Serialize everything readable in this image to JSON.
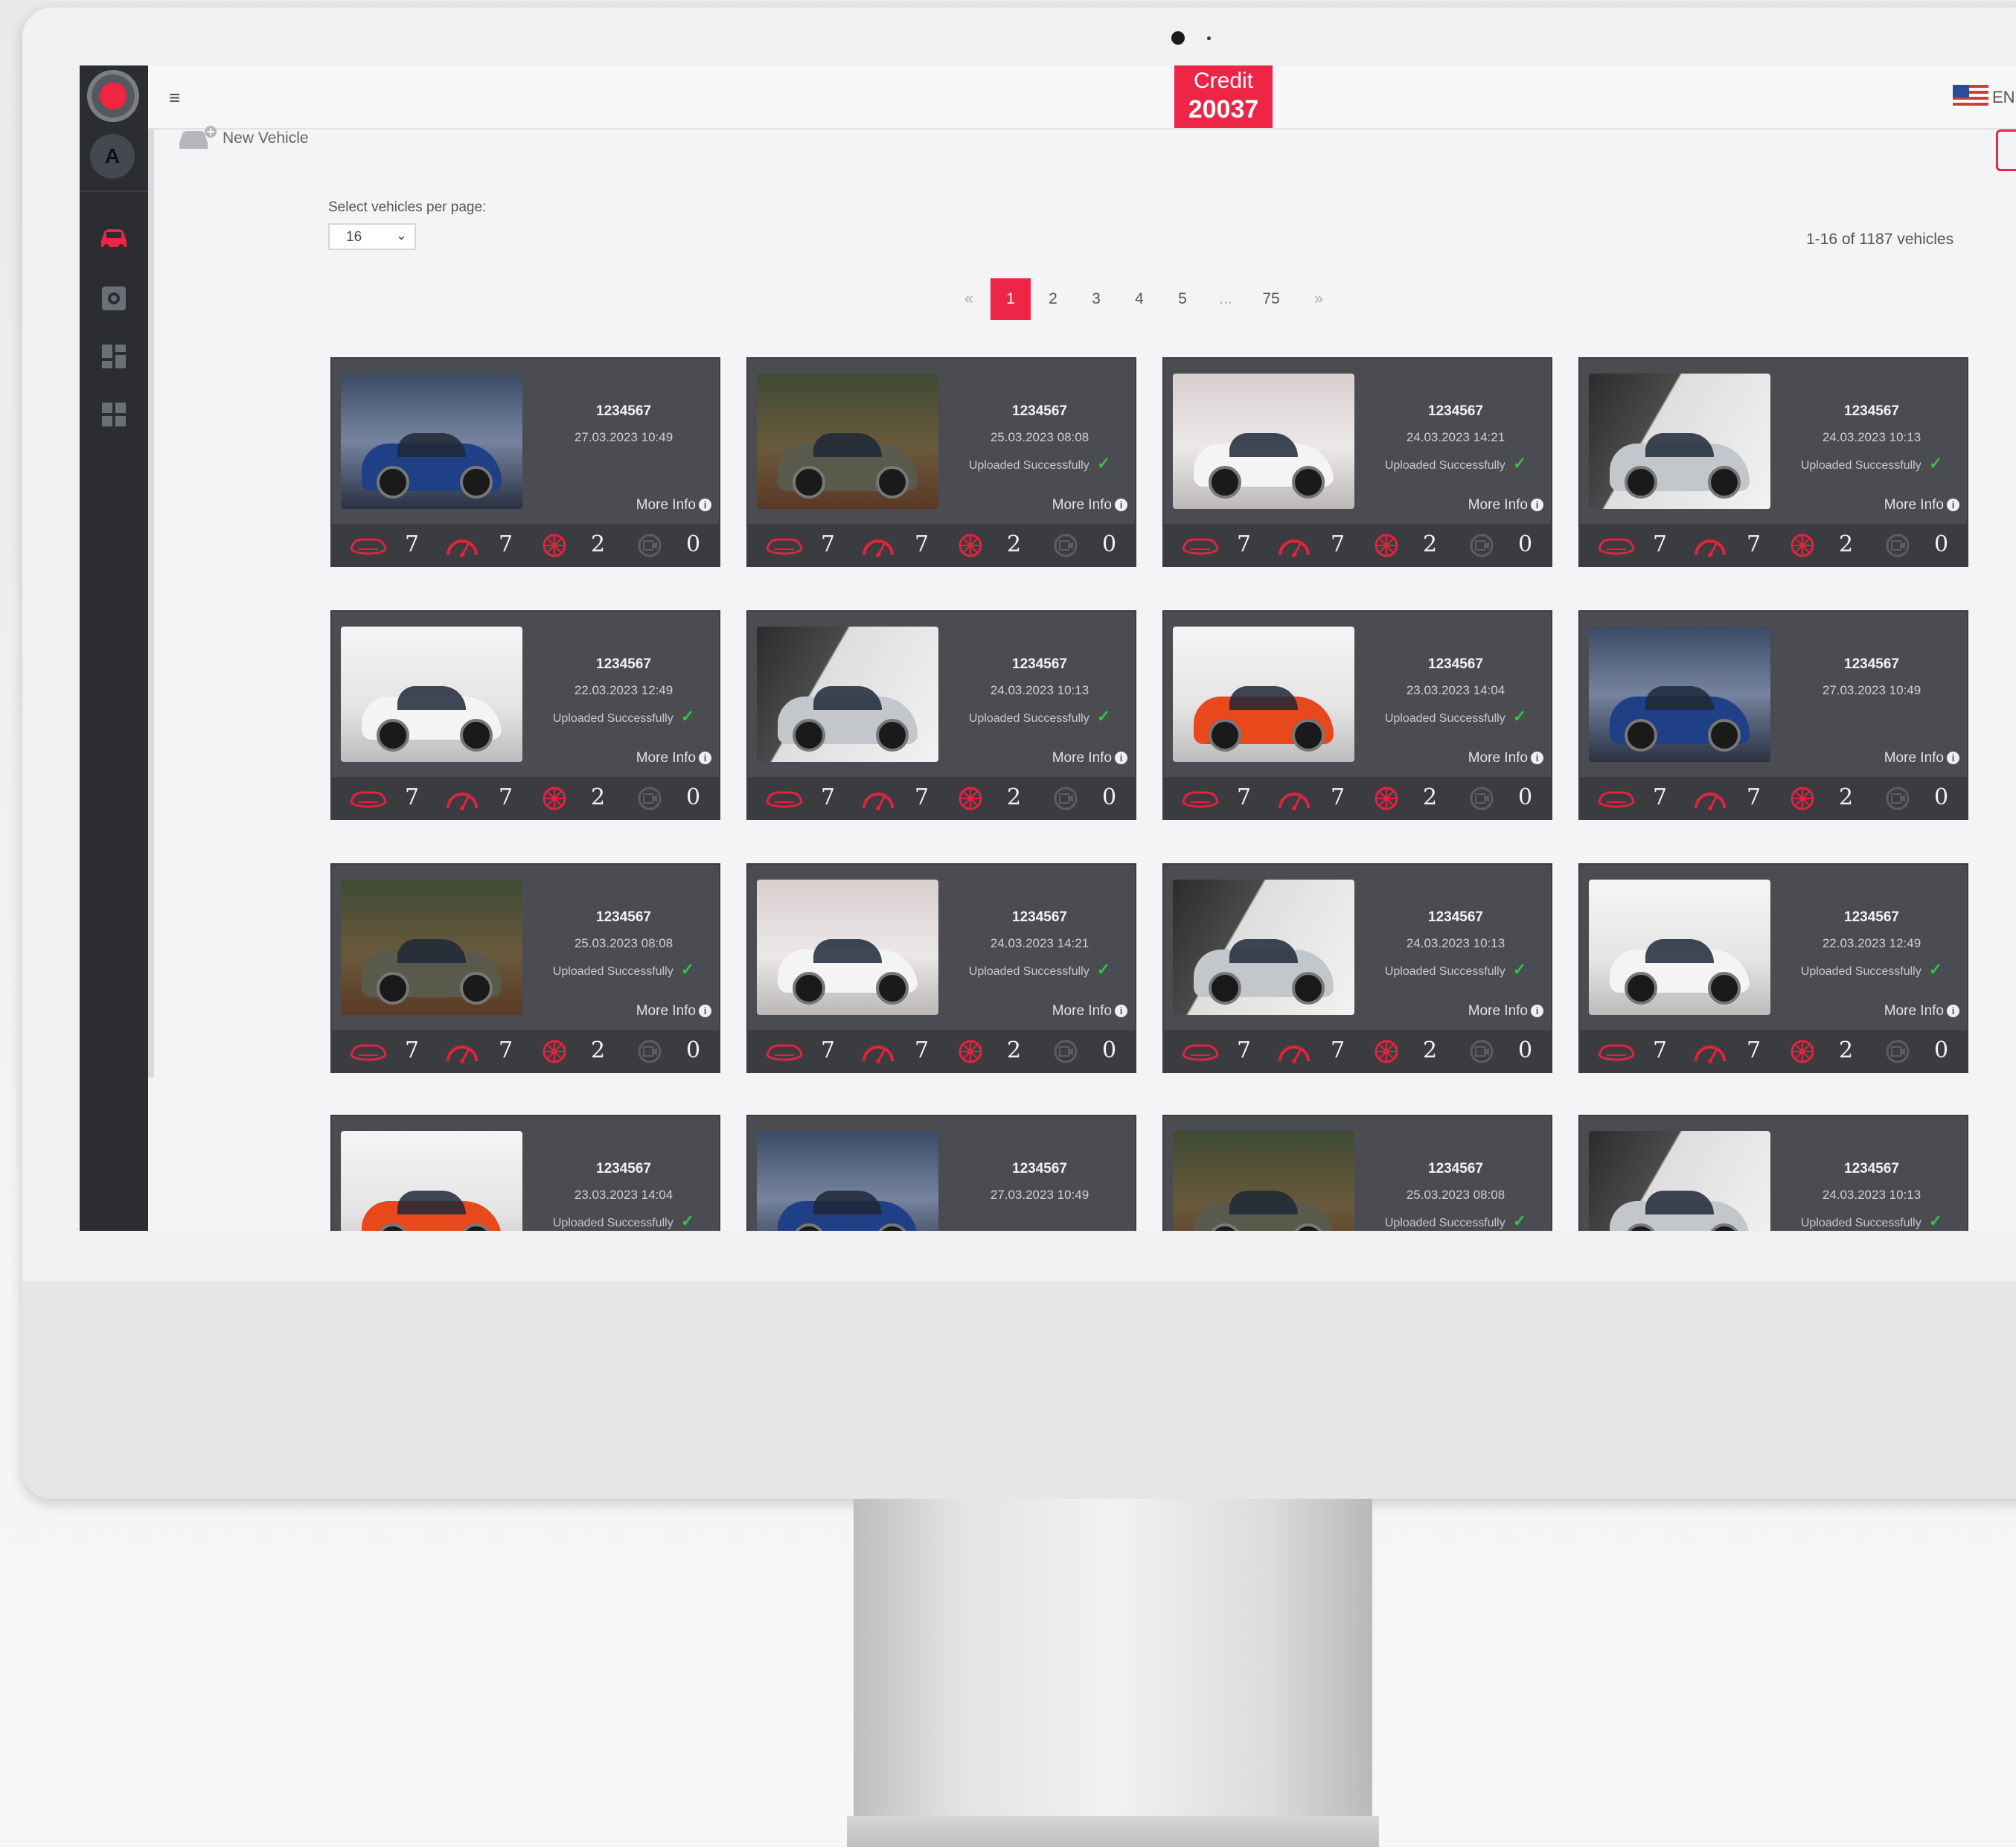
{
  "topbar": {
    "credit_label": "Credit",
    "credit_value": "20037",
    "language": "EN"
  },
  "toolbar": {
    "new_vehicle_label": "New Vehicle"
  },
  "per_page": {
    "label": "Select vehicles per page:",
    "value": "16"
  },
  "count_text": "1-16 of 1187 vehicles",
  "pagination": {
    "prev": "«",
    "pages": [
      "1",
      "2",
      "3",
      "4",
      "5",
      "...",
      "75"
    ],
    "next": "»",
    "active": "1"
  },
  "colors": {
    "accent": "#ee2547",
    "sidebar": "#2b2d31",
    "card": "#4a4c51",
    "success": "#32c24d"
  },
  "vehicles": [
    {
      "id": "1234567",
      "date": "27.03.2023 10:49",
      "status": "",
      "more": "More Info",
      "stats": [
        "7",
        "7",
        "2",
        "0"
      ],
      "image": "blue suv in studio"
    },
    {
      "id": "1234567",
      "date": "25.03.2023 08:08",
      "status": "Uploaded Successfully",
      "more": "More Info",
      "stats": [
        "7",
        "7",
        "2",
        "0"
      ],
      "image": "olive suv in forest studio"
    },
    {
      "id": "1234567",
      "date": "24.03.2023 14:21",
      "status": "Uploaded Successfully",
      "more": "More Info",
      "stats": [
        "7",
        "7",
        "2",
        "0"
      ],
      "image": "white sedan"
    },
    {
      "id": "1234567",
      "date": "24.03.2023 10:13",
      "status": "Uploaded Successfully",
      "more": "More Info",
      "stats": [
        "7",
        "7",
        "2",
        "0"
      ],
      "image": "silver suv catch studio"
    },
    {
      "id": "1234567",
      "date": "22.03.2023 12:49",
      "status": "Uploaded Successfully",
      "more": "More Info",
      "stats": [
        "7",
        "7",
        "2",
        "0"
      ],
      "image": "white sedan bright room"
    },
    {
      "id": "1234567",
      "date": "24.03.2023 10:13",
      "status": "Uploaded Successfully",
      "more": "More Info",
      "stats": [
        "7",
        "7",
        "2",
        "0"
      ],
      "image": "silver suv catch studio"
    },
    {
      "id": "1234567",
      "date": "23.03.2023 14:04",
      "status": "Uploaded Successfully",
      "more": "More Info",
      "stats": [
        "7",
        "7",
        "2",
        "0"
      ],
      "image": "orange hatchback"
    },
    {
      "id": "1234567",
      "date": "27.03.2023 10:49",
      "status": "",
      "more": "More Info",
      "stats": [
        "7",
        "7",
        "2",
        "0"
      ],
      "image": "blue suv in studio"
    },
    {
      "id": "1234567",
      "date": "25.03.2023 08:08",
      "status": "Uploaded Successfully",
      "more": "More Info",
      "stats": [
        "7",
        "7",
        "2",
        "0"
      ],
      "image": "olive suv in forest studio"
    },
    {
      "id": "1234567",
      "date": "24.03.2023 14:21",
      "status": "Uploaded Successfully",
      "more": "More Info",
      "stats": [
        "7",
        "7",
        "2",
        "0"
      ],
      "image": "white sedan"
    },
    {
      "id": "1234567",
      "date": "24.03.2023 10:13",
      "status": "Uploaded Successfully",
      "more": "More Info",
      "stats": [
        "7",
        "7",
        "2",
        "0"
      ],
      "image": "silver suv catch studio"
    },
    {
      "id": "1234567",
      "date": "22.03.2023 12:49",
      "status": "Uploaded Successfully",
      "more": "More Info",
      "stats": [
        "7",
        "7",
        "2",
        "0"
      ],
      "image": "white sedan bright room"
    },
    {
      "id": "1234567",
      "date": "23.03.2023 14:04",
      "status": "Uploaded Successfully",
      "more": "",
      "stats": [],
      "image": "orange hatchback"
    },
    {
      "id": "1234567",
      "date": "27.03.2023 10:49",
      "status": "",
      "more": "",
      "stats": [],
      "image": "blue suv in studio"
    },
    {
      "id": "1234567",
      "date": "25.03.2023 08:08",
      "status": "Uploaded Successfully",
      "more": "",
      "stats": [],
      "image": "olive suv in forest studio"
    },
    {
      "id": "1234567",
      "date": "24.03.2023 10:13",
      "status": "Uploaded Successfully",
      "more": "",
      "stats": [],
      "image": "silver suv catch studio"
    }
  ],
  "stat_icons": [
    "car-damage-icon",
    "speedometer-icon",
    "wheel-icon",
    "camera-icon"
  ],
  "sidebar_icons": [
    "vehicles-icon",
    "settings-icon",
    "dashboard-icon",
    "widgets-icon"
  ]
}
